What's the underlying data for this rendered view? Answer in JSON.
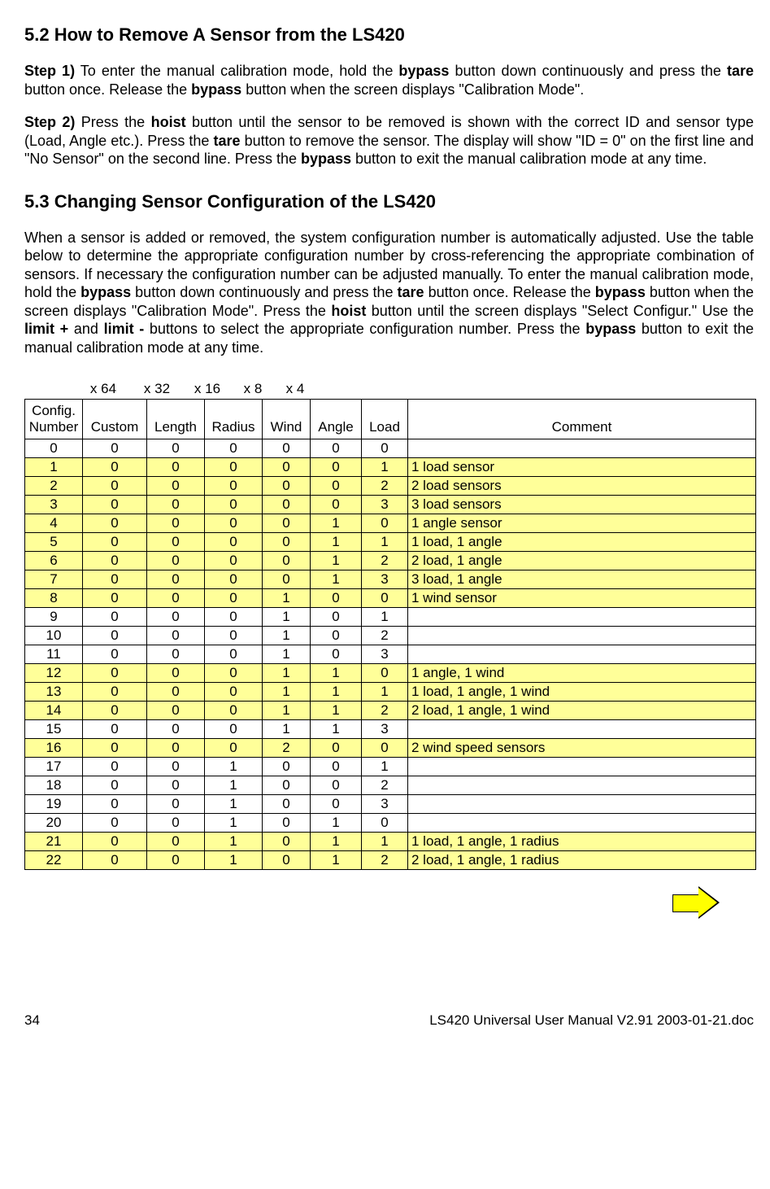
{
  "section52_title": "5.2 How to Remove A Sensor from the LS420",
  "step1_label": "Step 1)",
  "step1_a": "  To enter the manual calibration mode, hold the ",
  "step1_b": "bypass",
  "step1_c": " button down continuously and press the ",
  "step1_d": "tare",
  "step1_e": " button once. Release the ",
  "step1_f": "bypass",
  "step1_g": " button when the screen displays \"Calibration Mode\".",
  "step2_label": "Step 2)",
  "step2_a": "  Press the ",
  "step2_b": "hoist",
  "step2_c": " button until the sensor to be removed is shown with the correct ID and sensor type (Load, Angle etc.). Press the ",
  "step2_d": "tare",
  "step2_e": " button to remove the sensor. The display will show \"ID = 0\" on the first line and \"No Sensor\" on the second line. Press the ",
  "step2_f": "bypass",
  "step2_g": " button to exit the manual calibration mode at any time.",
  "section53_title": "5.3 Changing Sensor Configuration of the LS420",
  "p53_a": "When a sensor is added or removed, the system configuration number is automatically adjusted. Use the table below to determine the appropriate configuration number by cross-referencing the appropriate combination of sensors. If necessary the configuration number can be adjusted manually. To enter the manual calibration mode, hold the ",
  "p53_b": "bypass",
  "p53_c": " button down continuously and press the ",
  "p53_d": "tare",
  "p53_e": " button once. Release the ",
  "p53_f": "bypass",
  "p53_g": " button when the screen displays \"Calibration Mode\". Press the ",
  "p53_h": "hoist",
  "p53_i": " button until the screen displays \"Select Configur.\" Use the ",
  "p53_j": "limit +",
  "p53_k": " and ",
  "p53_l": "limit -",
  "p53_m": " buttons to select the appropriate configuration number. Press the ",
  "p53_n": "bypass",
  "p53_o": " button to exit the manual calibration mode at any time.",
  "mult": {
    "x64": "x 64",
    "x32": "x 32",
    "x16": "x 16",
    "x8": "x 8",
    "x4": "x 4"
  },
  "headers": {
    "config": "Config. Number",
    "custom": "Custom",
    "length": "Length",
    "radius": "Radius",
    "wind": "Wind",
    "angle": "Angle",
    "load": "Load",
    "comment": "Comment"
  },
  "rows": [
    {
      "n": "0",
      "cu": "0",
      "le": "0",
      "ra": "0",
      "wi": "0",
      "an": "0",
      "lo": "0",
      "co": "",
      "hl": false
    },
    {
      "n": "1",
      "cu": "0",
      "le": "0",
      "ra": "0",
      "wi": "0",
      "an": "0",
      "lo": "1",
      "co": "1 load sensor",
      "hl": true
    },
    {
      "n": "2",
      "cu": "0",
      "le": "0",
      "ra": "0",
      "wi": "0",
      "an": "0",
      "lo": "2",
      "co": "2 load sensors",
      "hl": true
    },
    {
      "n": "3",
      "cu": "0",
      "le": "0",
      "ra": "0",
      "wi": "0",
      "an": "0",
      "lo": "3",
      "co": "3 load sensors",
      "hl": true
    },
    {
      "n": "4",
      "cu": "0",
      "le": "0",
      "ra": "0",
      "wi": "0",
      "an": "1",
      "lo": "0",
      "co": "1 angle sensor",
      "hl": true
    },
    {
      "n": "5",
      "cu": "0",
      "le": "0",
      "ra": "0",
      "wi": "0",
      "an": "1",
      "lo": "1",
      "co": "1 load, 1 angle",
      "hl": true
    },
    {
      "n": "6",
      "cu": "0",
      "le": "0",
      "ra": "0",
      "wi": "0",
      "an": "1",
      "lo": "2",
      "co": "2 load, 1 angle",
      "hl": true
    },
    {
      "n": "7",
      "cu": "0",
      "le": "0",
      "ra": "0",
      "wi": "0",
      "an": "1",
      "lo": "3",
      "co": "3 load, 1 angle",
      "hl": true
    },
    {
      "n": "8",
      "cu": "0",
      "le": "0",
      "ra": "0",
      "wi": "1",
      "an": "0",
      "lo": "0",
      "co": "1 wind sensor",
      "hl": true
    },
    {
      "n": "9",
      "cu": "0",
      "le": "0",
      "ra": "0",
      "wi": "1",
      "an": "0",
      "lo": "1",
      "co": "",
      "hl": false
    },
    {
      "n": "10",
      "cu": "0",
      "le": "0",
      "ra": "0",
      "wi": "1",
      "an": "0",
      "lo": "2",
      "co": "",
      "hl": false
    },
    {
      "n": "11",
      "cu": "0",
      "le": "0",
      "ra": "0",
      "wi": "1",
      "an": "0",
      "lo": "3",
      "co": "",
      "hl": false
    },
    {
      "n": "12",
      "cu": "0",
      "le": "0",
      "ra": "0",
      "wi": "1",
      "an": "1",
      "lo": "0",
      "co": "1 angle, 1 wind",
      "hl": true
    },
    {
      "n": "13",
      "cu": "0",
      "le": "0",
      "ra": "0",
      "wi": "1",
      "an": "1",
      "lo": "1",
      "co": "1 load, 1 angle, 1 wind",
      "hl": true
    },
    {
      "n": "14",
      "cu": "0",
      "le": "0",
      "ra": "0",
      "wi": "1",
      "an": "1",
      "lo": "2",
      "co": "2 load, 1 angle, 1 wind",
      "hl": true
    },
    {
      "n": "15",
      "cu": "0",
      "le": "0",
      "ra": "0",
      "wi": "1",
      "an": "1",
      "lo": "3",
      "co": "",
      "hl": false
    },
    {
      "n": "16",
      "cu": "0",
      "le": "0",
      "ra": "0",
      "wi": "2",
      "an": "0",
      "lo": "0",
      "co": "2 wind speed sensors",
      "hl": true
    },
    {
      "n": "17",
      "cu": "0",
      "le": "0",
      "ra": "1",
      "wi": "0",
      "an": "0",
      "lo": "1",
      "co": "",
      "hl": false
    },
    {
      "n": "18",
      "cu": "0",
      "le": "0",
      "ra": "1",
      "wi": "0",
      "an": "0",
      "lo": "2",
      "co": "",
      "hl": false
    },
    {
      "n": "19",
      "cu": "0",
      "le": "0",
      "ra": "1",
      "wi": "0",
      "an": "0",
      "lo": "3",
      "co": "",
      "hl": false
    },
    {
      "n": "20",
      "cu": "0",
      "le": "0",
      "ra": "1",
      "wi": "0",
      "an": "1",
      "lo": "0",
      "co": "",
      "hl": false
    },
    {
      "n": "21",
      "cu": "0",
      "le": "0",
      "ra": "1",
      "wi": "0",
      "an": "1",
      "lo": "1",
      "co": "1 load, 1 angle, 1 radius",
      "hl": true
    },
    {
      "n": "22",
      "cu": "0",
      "le": "0",
      "ra": "1",
      "wi": "0",
      "an": "1",
      "lo": "2",
      "co": "2 load, 1 angle, 1 radius",
      "hl": true
    }
  ],
  "footer": {
    "page": "34",
    "doc": "LS420 Universal User Manual V2.91 2003-01-21.doc"
  }
}
